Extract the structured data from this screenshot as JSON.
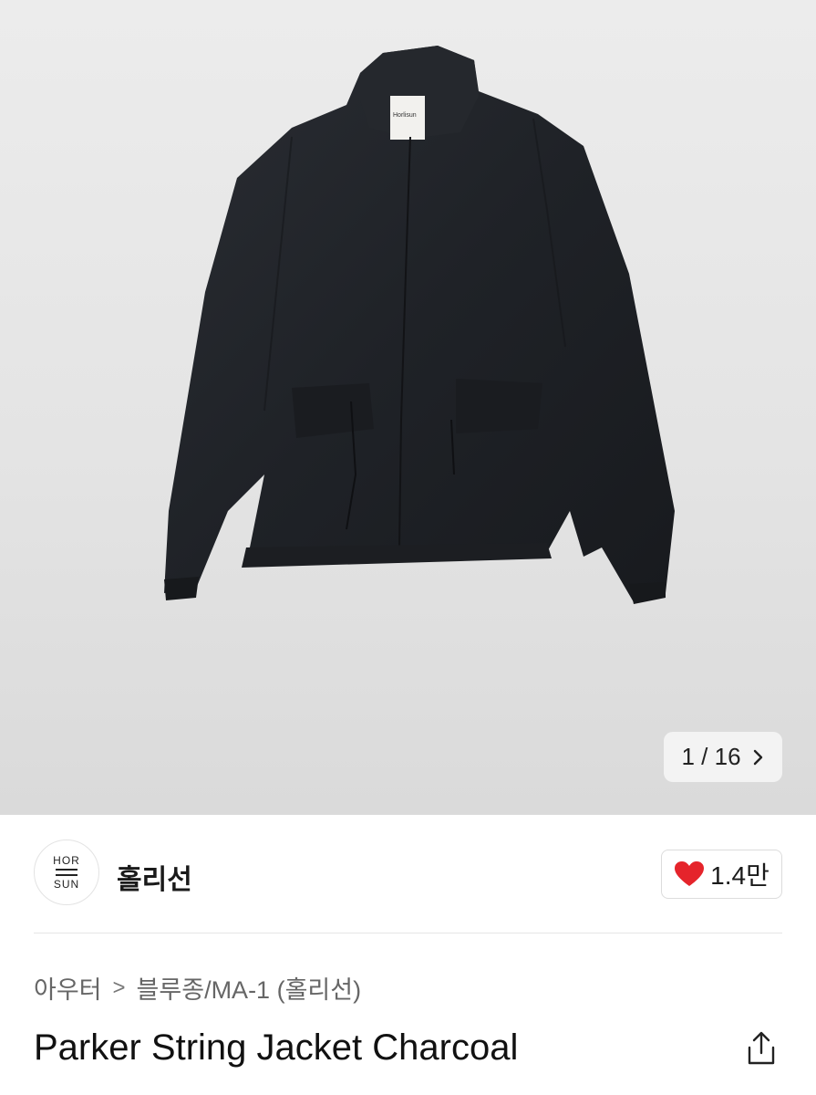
{
  "gallery": {
    "current": "1",
    "total": "16",
    "separator": "/",
    "next_icon": "chevron-right-icon",
    "garment_label": "Horlisun"
  },
  "brand": {
    "logo_top": "HOR",
    "logo_bottom": "SUN",
    "name": "홀리선"
  },
  "like": {
    "count": "1.4만",
    "icon": "heart-icon",
    "color": "#e5242b"
  },
  "breadcrumb": {
    "category": "아우터",
    "separator": ">",
    "subcategory": "블루종/MA-1 (홀리선)"
  },
  "product": {
    "title": "Parker String Jacket Charcoal",
    "share_icon": "share-icon"
  }
}
